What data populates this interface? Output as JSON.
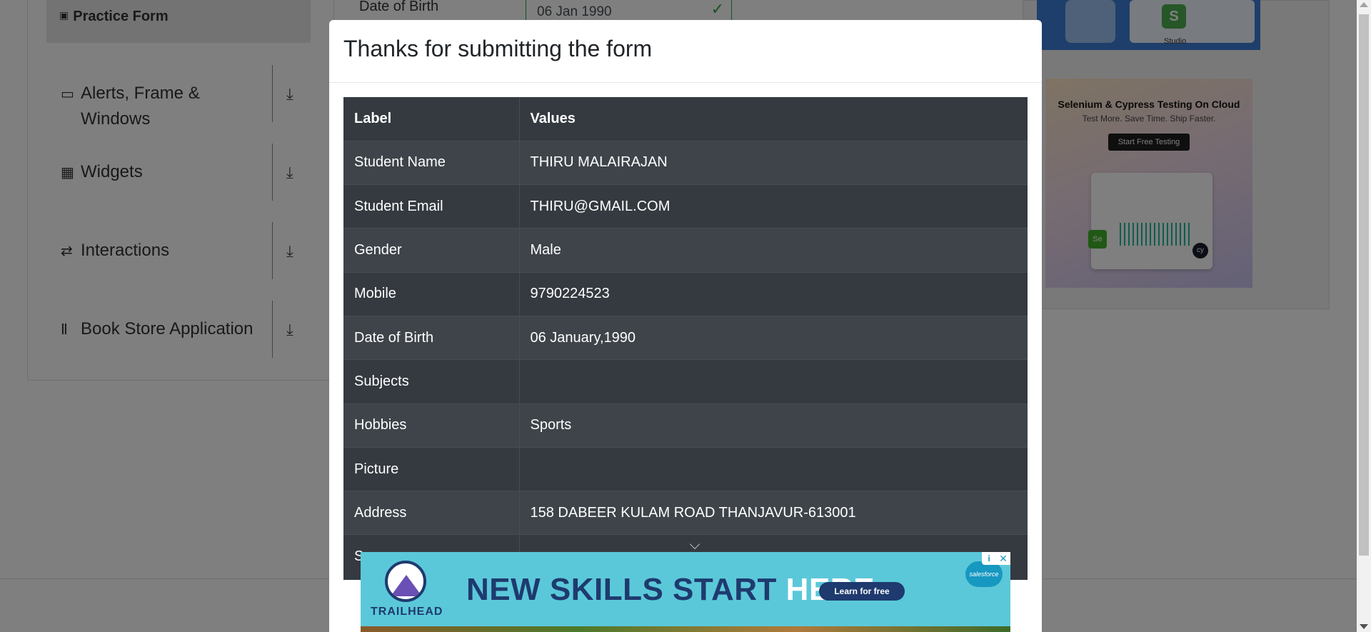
{
  "sidebar": {
    "practice_form": "Practice Form",
    "categories": [
      {
        "label": "Alerts, Frame & Windows",
        "icon": "window-icon"
      },
      {
        "label": "Widgets",
        "icon": "widgets-icon"
      },
      {
        "label": "Interactions",
        "icon": "interactions-icon"
      },
      {
        "label": "Book Store Application",
        "icon": "bookstore-icon"
      }
    ]
  },
  "form": {
    "date_label": "Date of Birth",
    "date_value": "06 Jan 1990"
  },
  "ads": {
    "top_studio": "Studio",
    "cloud_title": "Selenium & Cypress Testing On Cloud",
    "cloud_subtitle": "Test More. Save Time. Ship Faster.",
    "cloud_button": "Start Free Testing",
    "trailhead_brand": "TRAILHEAD",
    "trailhead_headline_dark": "NEW SKILLS START",
    "trailhead_headline_light": "HERE.",
    "trailhead_cta": "Learn for free",
    "salesforce": "salesforce"
  },
  "modal": {
    "title": "Thanks for submitting the form",
    "headers": {
      "label": "Label",
      "values": "Values"
    },
    "rows": [
      {
        "label": "Student Name",
        "value": "THIRU MALAIRAJAN"
      },
      {
        "label": "Student Email",
        "value": "THIRU@GMAIL.COM"
      },
      {
        "label": "Gender",
        "value": "Male"
      },
      {
        "label": "Mobile",
        "value": "9790224523"
      },
      {
        "label": "Date of Birth",
        "value": "06 January,1990"
      },
      {
        "label": "Subjects",
        "value": ""
      },
      {
        "label": "Hobbies",
        "value": "Sports"
      },
      {
        "label": "Picture",
        "value": ""
      },
      {
        "label": "Address",
        "value": "158 DABEER KULAM ROAD THANJAVUR-613001"
      },
      {
        "label": "S",
        "value": ""
      }
    ]
  },
  "colors": {
    "table_dark": "#343a40",
    "table_stripe": "#3e444a",
    "success_green": "#28a745",
    "backdrop": "rgba(0,0,0,0.5)",
    "trailhead_blue": "#5bc8d9"
  }
}
